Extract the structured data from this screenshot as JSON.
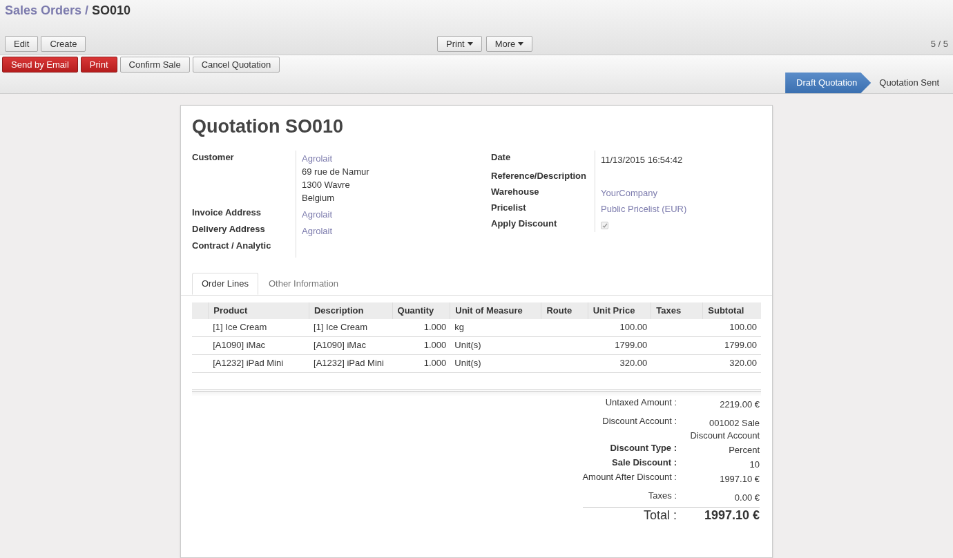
{
  "breadcrumb": {
    "parent": "Sales Orders",
    "separator": "/",
    "current": "SO010"
  },
  "toolbar": {
    "left_buttons": [
      "Edit",
      "Create"
    ],
    "center_buttons": [
      {
        "label": "Print"
      },
      {
        "label": "More"
      }
    ],
    "pager": "5 / 5"
  },
  "actions": [
    {
      "label": "Send by Email",
      "kind": "primary"
    },
    {
      "label": "Print",
      "kind": "primary"
    },
    {
      "label": "Confirm Sale",
      "kind": "default"
    },
    {
      "label": "Cancel Quotation",
      "kind": "default"
    }
  ],
  "stages": [
    {
      "label": "Draft Quotation",
      "selected": true
    },
    {
      "label": "Quotation Sent",
      "selected": false
    }
  ],
  "form": {
    "title": "Quotation SO010",
    "left_fields": [
      {
        "label": "Customer",
        "values": [
          {
            "text": "Agrolait",
            "kind": "link"
          },
          {
            "text": "69 rue de Namur",
            "kind": "text"
          },
          {
            "text": "1300 Wavre",
            "kind": "text"
          },
          {
            "text": "Belgium",
            "kind": "text"
          }
        ]
      },
      {
        "label": "Invoice Address",
        "values": [
          {
            "text": "Agrolait",
            "kind": "link"
          }
        ]
      },
      {
        "label": "Delivery Address",
        "values": [
          {
            "text": "Agrolait",
            "kind": "link"
          }
        ]
      },
      {
        "label": "Contract / Analytic"
      }
    ],
    "right_fields": [
      {
        "label": "Date",
        "kind": "text",
        "value": "11/13/2015 16:54:42"
      },
      {
        "label": "Reference/Description",
        "kind": "text"
      },
      {
        "label": "Warehouse",
        "kind": "link",
        "value": "YourCompany"
      },
      {
        "label": "Pricelist",
        "kind": "link",
        "value": "Public Pricelist (EUR)"
      },
      {
        "label": "Apply Discount",
        "kind": "checkbox",
        "checked": true
      }
    ]
  },
  "tabs": [
    {
      "label": "Order Lines",
      "selected": true
    },
    {
      "label": "Other Information",
      "selected": false
    }
  ],
  "table": {
    "columns": [
      "Product",
      "Description",
      "Quantity",
      "Unit of Measure",
      "Route",
      "Unit Price",
      "Taxes",
      "Subtotal"
    ],
    "rows": [
      [
        "[1] Ice Cream",
        "[1] Ice Cream",
        "1.000",
        "kg",
        "",
        "100.00",
        "",
        "100.00"
      ],
      [
        "[A1090] iMac",
        "[A1090] iMac",
        "1.000",
        "Unit(s)",
        "",
        "1799.00",
        "",
        "1799.00"
      ],
      [
        "[A1232] iPad Mini",
        "[A1232] iPad Mini",
        "1.000",
        "Unit(s)",
        "",
        "320.00",
        "",
        "320.00"
      ]
    ]
  },
  "totals": [
    {
      "label": "Untaxed Amount :",
      "value": "2219.00 €",
      "bold": false
    },
    {
      "label": "Discount Account :",
      "value": "001002 Sale Discount Account",
      "bold": false
    },
    {
      "label": "Discount Type :",
      "value": "Percent",
      "bold": true
    },
    {
      "label": "Sale Discount :",
      "value": "10",
      "bold": true
    },
    {
      "label": "Amount After Discount :",
      "value": "1997.10 €",
      "bold": false
    },
    {
      "label": "Taxes :",
      "value": "0.00 €",
      "bold": false
    }
  ],
  "total": {
    "label": "Total :",
    "value": "1997.10 €"
  }
}
